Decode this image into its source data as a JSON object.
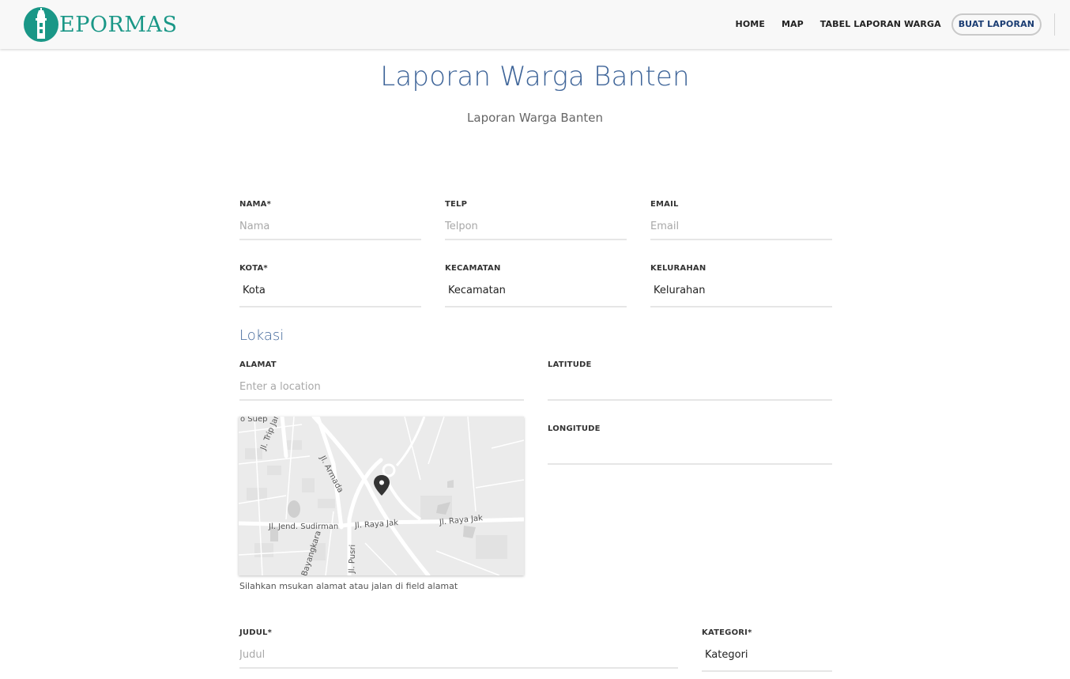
{
  "brand": {
    "name": "EPORMAS"
  },
  "nav": {
    "home": "HOME",
    "map": "MAP",
    "table": "TABEL LAPORAN WARGA",
    "create": "BUAT LAPORAN"
  },
  "page": {
    "title": "Laporan Warga Banten",
    "subtitle": "Laporan Warga Banten"
  },
  "form": {
    "nama": {
      "label": "NAMA*",
      "placeholder": "Nama"
    },
    "telp": {
      "label": "TELP",
      "placeholder": "Telpon"
    },
    "email": {
      "label": "EMAIL",
      "placeholder": "Email"
    },
    "kota": {
      "label": "KOTA*",
      "value": "Kota"
    },
    "kecamatan": {
      "label": "KECAMATAN",
      "value": "Kecamatan"
    },
    "kelurahan": {
      "label": "KELURAHAN",
      "value": "Kelurahan"
    },
    "lokasi_heading": "Lokasi",
    "alamat": {
      "label": "ALAMAT",
      "placeholder": "Enter a location"
    },
    "latitude": {
      "label": "LATITUDE",
      "value": ""
    },
    "longitude": {
      "label": "LONGITUDE",
      "value": ""
    },
    "map_help": "Silahkan msukan alamat atau jalan di field alamat",
    "judul": {
      "label": "JUDUL*",
      "placeholder": "Judul"
    },
    "kategori": {
      "label": "KATEGORI*",
      "value": "Kategori"
    }
  },
  "map": {
    "labels": {
      "suep": "o Suep",
      "trip": "Jl. Trip Jamaksari",
      "armada": "Jl. Armada",
      "sudirman": "Jl. Jend. Sudirman",
      "raya1": "Jl. Raya Jak",
      "raya2": "Jl. Raya Jak",
      "pusri": "Jl. Pusri",
      "bayangkara": "Bayangkara"
    }
  },
  "colors": {
    "brand": "#1a9787",
    "title": "#3f6599",
    "nav_button_text": "#1b3d73"
  },
  "icons": {
    "logo": "lighthouse-logo-icon",
    "map_marker": "map-pin-icon"
  }
}
